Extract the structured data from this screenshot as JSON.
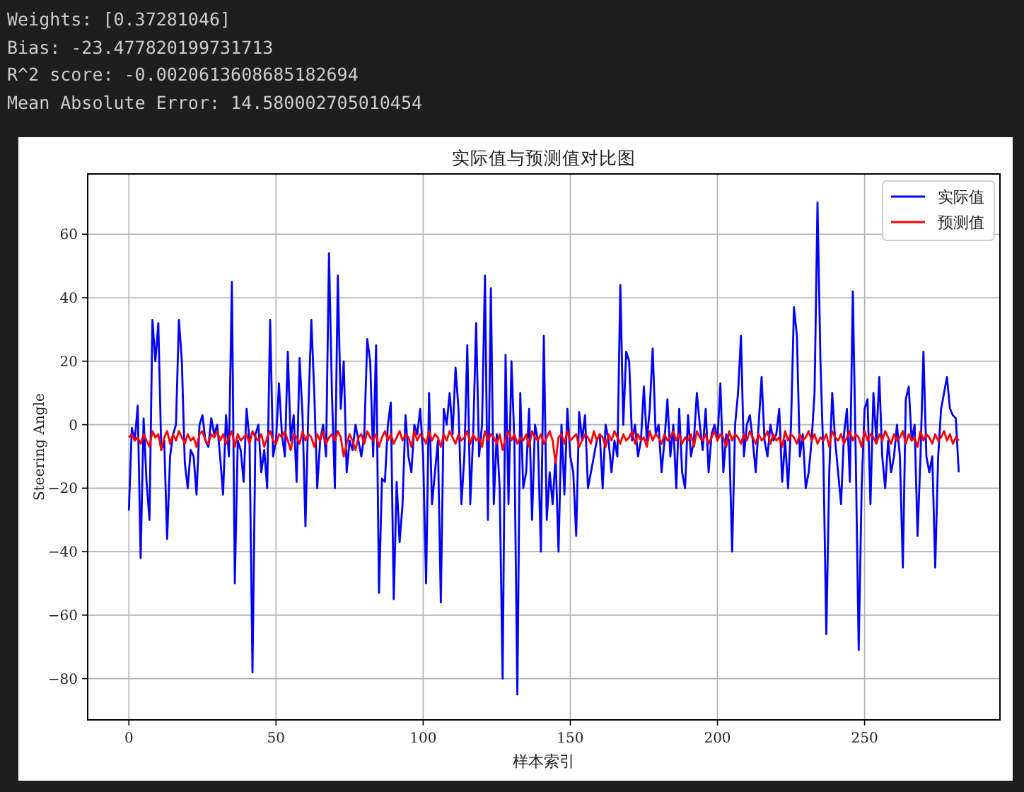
{
  "output_lines": [
    "Weights: [0.37281046]",
    "Bias: -23.477820199731713",
    "R^2 score: -0.0020613608685182694",
    "Mean Absolute Error: 14.580002705010454"
  ],
  "figure": {
    "chart_data": {
      "type": "line",
      "title": "实际值与预测值对比图",
      "xlabel": "样本索引",
      "ylabel": "Steering Angle",
      "grid": true,
      "legend": true,
      "x": [
        0,
        1,
        2,
        3,
        4,
        5,
        6,
        7,
        8,
        9,
        10,
        11,
        12,
        13,
        14,
        15,
        16,
        17,
        18,
        19,
        20,
        21,
        22,
        23,
        24,
        25,
        26,
        27,
        28,
        29,
        30,
        31,
        32,
        33,
        34,
        35,
        36,
        37,
        38,
        39,
        40,
        41,
        42,
        43,
        44,
        45,
        46,
        47,
        48,
        49,
        50,
        51,
        52,
        53,
        54,
        55,
        56,
        57,
        58,
        59,
        60,
        61,
        62,
        63,
        64,
        65,
        66,
        67,
        68,
        69,
        70,
        71,
        72,
        73,
        74,
        75,
        76,
        77,
        78,
        79,
        80,
        81,
        82,
        83,
        84,
        85,
        86,
        87,
        88,
        89,
        90,
        91,
        92,
        93,
        94,
        95,
        96,
        97,
        98,
        99,
        100,
        101,
        102,
        103,
        104,
        105,
        106,
        107,
        108,
        109,
        110,
        111,
        112,
        113,
        114,
        115,
        116,
        117,
        118,
        119,
        120,
        121,
        122,
        123,
        124,
        125,
        126,
        127,
        128,
        129,
        130,
        131,
        132,
        133,
        134,
        135,
        136,
        137,
        138,
        139,
        140,
        141,
        142,
        143,
        144,
        145,
        146,
        147,
        148,
        149,
        150,
        151,
        152,
        153,
        154,
        155,
        156,
        157,
        158,
        159,
        160,
        161,
        162,
        163,
        164,
        165,
        166,
        167,
        168,
        169,
        170,
        171,
        172,
        173,
        174,
        175,
        176,
        177,
        178,
        179,
        180,
        181,
        182,
        183,
        184,
        185,
        186,
        187,
        188,
        189,
        190,
        191,
        192,
        193,
        194,
        195,
        196,
        197,
        198,
        199,
        200,
        201,
        202,
        203,
        204,
        205,
        206,
        207,
        208,
        209,
        210,
        211,
        212,
        213,
        214,
        215,
        216,
        217,
        218,
        219,
        220,
        221,
        222,
        223,
        224,
        225,
        226,
        227,
        228,
        229,
        230,
        231,
        232,
        233,
        234,
        235,
        236,
        237,
        238,
        239,
        240,
        241,
        242,
        243,
        244,
        245,
        246,
        247,
        248,
        249,
        250,
        251,
        252,
        253,
        254,
        255,
        256,
        257,
        258,
        259,
        260,
        261,
        262,
        263,
        264,
        265,
        266,
        267,
        268,
        269,
        270,
        271,
        272,
        273,
        274,
        275,
        276,
        277,
        278,
        279,
        280,
        281,
        282
      ],
      "xlim": [
        -14,
        296
      ],
      "ylim": [
        -93,
        79
      ],
      "xticks": [
        0,
        50,
        100,
        150,
        200,
        250
      ],
      "yticks": [
        {
          "value": -80,
          "label": "−80"
        },
        {
          "value": -60,
          "label": "−60"
        },
        {
          "value": -40,
          "label": "−40"
        },
        {
          "value": -20,
          "label": "−20"
        },
        {
          "value": 0,
          "label": "0"
        },
        {
          "value": 20,
          "label": "20"
        },
        {
          "value": 40,
          "label": "40"
        },
        {
          "value": 60,
          "label": "60"
        }
      ],
      "series": [
        {
          "name": "实际值",
          "color": "#0000ff",
          "values": [
            -27,
            -1,
            -5,
            6,
            -42,
            2,
            -18,
            -30,
            33,
            20,
            32,
            -8,
            -5,
            -36,
            -10,
            -3,
            0,
            33,
            20,
            -12,
            -20,
            -8,
            -10,
            -22,
            0,
            3,
            -5,
            -7,
            2,
            -3,
            0,
            -10,
            -22,
            3,
            -10,
            45,
            -50,
            -5,
            -8,
            -18,
            5,
            -5,
            -78,
            -3,
            0,
            -15,
            -8,
            -20,
            33,
            -10,
            -5,
            13,
            -3,
            -10,
            23,
            -5,
            3,
            -18,
            21,
            3,
            -32,
            5,
            33,
            10,
            -20,
            -5,
            0,
            -10,
            54,
            10,
            -20,
            47,
            5,
            20,
            -15,
            -5,
            -8,
            0,
            -5,
            -10,
            -3,
            27,
            20,
            -10,
            25,
            -53,
            -17,
            -18,
            0,
            7,
            -55,
            -18,
            -37,
            -25,
            3,
            -10,
            -15,
            0,
            -3,
            5,
            -10,
            -50,
            10,
            -25,
            -15,
            -5,
            -56,
            5,
            0,
            10,
            -3,
            18,
            5,
            -25,
            -10,
            25,
            -25,
            -3,
            32,
            -10,
            0,
            47,
            -30,
            43,
            -25,
            -3,
            -20,
            -80,
            22,
            -25,
            20,
            -5,
            -85,
            10,
            -20,
            -15,
            5,
            -30,
            0,
            -5,
            -40,
            28,
            -30,
            -15,
            -25,
            -10,
            -40,
            0,
            -22,
            5,
            -10,
            -15,
            -35,
            4,
            -5,
            3,
            -20,
            -15,
            -10,
            -5,
            -3,
            -20,
            0,
            -5,
            -15,
            -5,
            -10,
            44,
            0,
            23,
            20,
            -5,
            0,
            -10,
            -5,
            12,
            -5,
            5,
            24,
            -3,
            0,
            -15,
            -5,
            8,
            -10,
            0,
            -20,
            5,
            -15,
            -20,
            3,
            -10,
            -5,
            10,
            0,
            -8,
            5,
            -15,
            -3,
            0,
            -5,
            13,
            -15,
            -3,
            -5,
            -40,
            0,
            10,
            28,
            -10,
            0,
            3,
            -5,
            -15,
            0,
            15,
            -5,
            -10,
            0,
            -5,
            -3,
            5,
            -18,
            -5,
            -20,
            0,
            37,
            28,
            -10,
            -3,
            -20,
            -15,
            -5,
            10,
            70,
            20,
            -10,
            -66,
            -15,
            10,
            -5,
            -15,
            -25,
            -3,
            5,
            -18,
            42,
            -10,
            -71,
            -20,
            5,
            8,
            -25,
            10,
            -5,
            15,
            -10,
            -20,
            -5,
            -15,
            -10,
            0,
            -10,
            -45,
            8,
            12,
            -5,
            0,
            -35,
            -10,
            23,
            -10,
            -15,
            -10,
            -45,
            -10,
            5,
            10,
            15,
            5,
            3,
            2,
            -15
          ]
        },
        {
          "name": "预测值",
          "color": "#ff0000",
          "values": [
            -4,
            -3,
            -5,
            -4,
            -6,
            -3,
            -5,
            -7,
            -2,
            -4,
            -3,
            -8,
            -4,
            -2,
            -6,
            -3,
            -5,
            -2,
            -4,
            -6,
            -3,
            -5,
            -4,
            -7,
            -3,
            -2,
            -5,
            -6,
            -3,
            -4,
            -2,
            -5,
            -3,
            -6,
            -4,
            -2,
            -7,
            -3,
            -5,
            -4,
            -3,
            -6,
            -2,
            -4,
            -5,
            -3,
            -7,
            -4,
            -2,
            -5,
            -6,
            -3,
            -4,
            -2,
            -5,
            -8,
            -3,
            -4,
            -6,
            -2,
            -5,
            -3,
            -4,
            -7,
            -3,
            -5,
            -2,
            -6,
            -4,
            -3,
            -5,
            -2,
            -4,
            -10,
            -6,
            -3,
            -5,
            -8,
            -4,
            -3,
            -6,
            -2,
            -4,
            -5,
            -3,
            -7,
            -4,
            -2,
            -5,
            -3,
            -6,
            -4,
            -2,
            -5,
            -3,
            -4,
            -7,
            -2,
            -5,
            -3,
            -4,
            -6,
            -2,
            -5,
            -3,
            -4,
            -7,
            -3,
            -5,
            -2,
            -4,
            -6,
            -3,
            -5,
            -4,
            -2,
            -6,
            -3,
            -5,
            -4,
            -7,
            -2,
            -5,
            -3,
            -4,
            -6,
            -3,
            -8,
            -4,
            -2,
            -5,
            -3,
            -6,
            -4,
            -5,
            -3,
            -7,
            -2,
            -4,
            -5,
            -3,
            -6,
            -4,
            -2,
            -5,
            -12,
            -4,
            -3,
            -6,
            -2,
            -5,
            -4,
            -3,
            -7,
            -5,
            -3,
            -4,
            -6,
            -2,
            -5,
            -3,
            -4,
            -7,
            -3,
            -5,
            -2,
            -4,
            -6,
            -3,
            -5,
            -4,
            -2,
            -6,
            -3,
            -5,
            -4,
            -7,
            -2,
            -5,
            -3,
            -4,
            -6,
            -3,
            -5,
            -4,
            -2,
            -5,
            -3,
            -6,
            -4,
            -5,
            -3,
            -7,
            -2,
            -4,
            -5,
            -3,
            -6,
            -4,
            -2,
            -5,
            -3,
            -4,
            -7,
            -2,
            -5,
            -3,
            -4,
            -6,
            -3,
            -5,
            -2,
            -4,
            -6,
            -3,
            -5,
            -4,
            -2,
            -6,
            -3,
            -5,
            -4,
            -7,
            -2,
            -5,
            -3,
            -4,
            -6,
            -3,
            -5,
            -4,
            -2,
            -5,
            -3,
            -6,
            -4,
            -5,
            -3,
            -7,
            -2,
            -4,
            -5,
            -3,
            -6,
            -4,
            -2,
            -5,
            -3,
            -4,
            -7,
            -2,
            -5,
            -3,
            -4,
            -6,
            -3,
            -5,
            -2,
            -4,
            -6,
            -3,
            -5,
            -4,
            -2,
            -6,
            -3,
            -5,
            -4,
            -7,
            -2,
            -5,
            -3,
            -4,
            -6,
            -3,
            -5,
            -4,
            -2,
            -5,
            -3,
            -6,
            -4,
            -5
          ]
        }
      ]
    }
  }
}
